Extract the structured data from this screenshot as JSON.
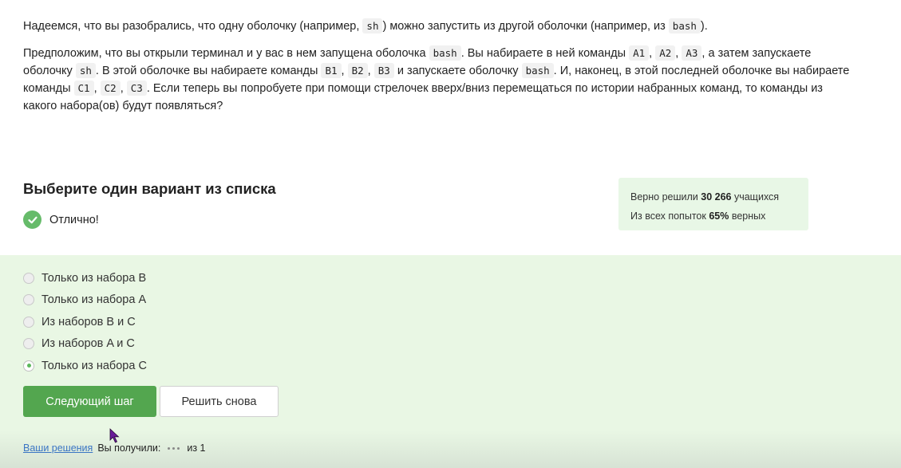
{
  "question": {
    "p1": [
      "Надеемся, что вы разобрались, что одну оболочку (например, ",
      "sh",
      ") можно запустить из другой оболочки (например, из ",
      "bash",
      ")."
    ],
    "p2": [
      "Предположим, что вы открыли терминал и у вас в нем запущена оболочка ",
      "bash",
      ". Вы набираете в ней команды ",
      "A1",
      ", ",
      "A2",
      ", ",
      "A3",
      ", а затем запускаете оболочку ",
      "sh",
      ". В этой оболочке вы набираете команды ",
      "B1",
      ", ",
      "B2",
      ", ",
      "B3",
      " и запускаете оболочку ",
      "bash",
      ". И, наконец, в этой последней оболочке вы набираете команды ",
      "C1",
      ", ",
      "C2",
      ", ",
      "C3",
      ". Если теперь вы попробуете при помощи стрелочек вверх/вниз перемещаться по истории набранных команд, то команды из какого набора(ов) будут появляться?"
    ]
  },
  "select_title": "Выберите один вариант из списка",
  "status_text": "Отлично!",
  "stats": {
    "line1_prefix": "Верно решили",
    "line1_count": "30 266",
    "line1_suffix": "учащихся",
    "line2_prefix": "Из всех попыток",
    "line2_percent": "65%",
    "line2_suffix": "верных"
  },
  "options": [
    {
      "label": "Только из набора B",
      "checked": false
    },
    {
      "label": "Только из набора A",
      "checked": false
    },
    {
      "label": "Из наборов B и C",
      "checked": false
    },
    {
      "label": "Из наборов A и C",
      "checked": false
    },
    {
      "label": "Только из набора C",
      "checked": true
    }
  ],
  "buttons": {
    "next": "Следующий шаг",
    "retry": "Решить снова"
  },
  "footer": {
    "solutions_link": "Ваши решения",
    "received": "Вы получили:",
    "out_of": "из 1"
  },
  "colors": {
    "accent_green": "#53a64f",
    "area_bg": "#e9f7e4",
    "stats_bg": "#e8f7e6",
    "link": "#3a75c4"
  }
}
